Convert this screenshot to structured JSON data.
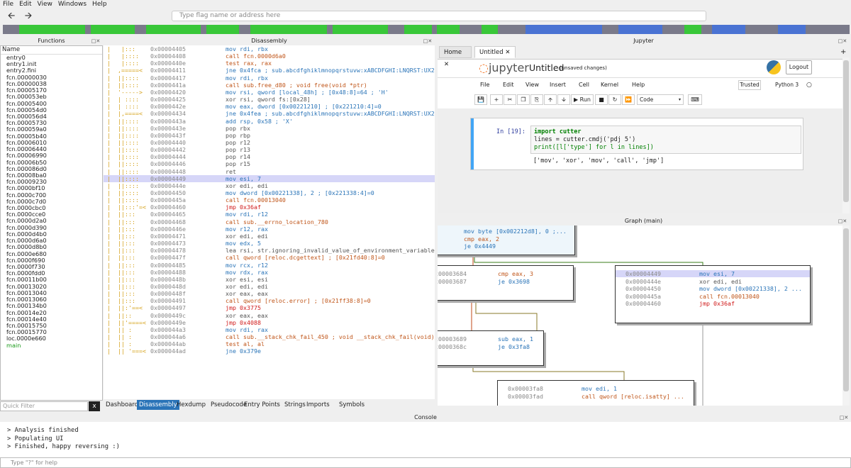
{
  "menu": [
    "File",
    "Edit",
    "View",
    "Windows",
    "Help"
  ],
  "flag_placeholder": "Type flag name or address here",
  "overview_colors": {
    "green": "#39c739",
    "grey": "#7a7a8a",
    "blue": "#4a73d3"
  },
  "functions": {
    "title": "Functions",
    "header": "Name",
    "items": [
      "entry0",
      "entry1.init",
      "entry2.fini",
      "fcn.00000030",
      "fcn.00000038",
      "fcn.00005170",
      "fcn.000053eb",
      "fcn.00005400",
      "fcn.000054d0",
      "fcn.000056d4",
      "fcn.00005730",
      "fcn.000059a0",
      "fcn.00005b40",
      "fcn.00006010",
      "fcn.00006440",
      "fcn.00006990",
      "fcn.00006b50",
      "fcn.000086d0",
      "fcn.00008ba0",
      "fcn.00009230",
      "fcn.0000bf10",
      "fcn.0000c700",
      "fcn.0000c7d0",
      "fcn.0000cbc0",
      "fcn.0000cce0",
      "fcn.0000d2a0",
      "fcn.0000d390",
      "fcn.0000d4b0",
      "fcn.0000d6a0",
      "fcn.0000d8b0",
      "fcn.0000e680",
      "fcn.0000f690",
      "fcn.0000f730",
      "fcn.0000fdd0",
      "fcn.00011b00",
      "fcn.00013020",
      "fcn.00013040",
      "fcn.00013060",
      "fcn.000134b0",
      "fcn.00014e20",
      "fcn.00014e40",
      "fcn.00015750",
      "fcn.00015770",
      "loc.0000e660",
      "main"
    ],
    "filter_placeholder": "Quick Filter",
    "filter_clear": "x"
  },
  "disassembly": {
    "title": "Disassembly",
    "lines": [
      {
        "g": "|   |:::    ",
        "a": "0x00004405",
        "i": "mov rdi, rbx",
        "c": "#2a74b8"
      },
      {
        "g": "|   |::::  ",
        "a": "0x00004408",
        "i": "call fcn.0000d6a0",
        "c": "#c0561a"
      },
      {
        "g": "|   |::::  ",
        "a": "0x0000440e",
        "i": "test rax, rax",
        "c": "#c0561a"
      },
      {
        "g": "|  ,=====< ",
        "a": "0x00004411",
        "i": "jne 0x4fca ; sub.abcdfghiklmnopqrstuvw:xABCDFGHI:LNQRST:UX2",
        "c": "#2a74b8"
      },
      {
        "g": "|  ||::::  ",
        "a": "0x00004417",
        "i": "mov rdi, rbx",
        "c": "#2a74b8"
      },
      {
        "g": "|  ||::::  ",
        "a": "0x0000441a",
        "i": "call sub.free_d80 ; void free(void *ptr)",
        "c": "#c0561a"
      },
      {
        "g": "|  '-----> ",
        "a": "0x00004420",
        "i": "mov rsi, qword [local_48h] ; [0x48:8]=64 ; 'H'",
        "c": "#2a74b8"
      },
      {
        "g": "|  | ::::  ",
        "a": "0x00004425",
        "i": "xor rsi, qword fs:[0x28]",
        "c": "#555"
      },
      {
        "g": "|  | ::::  ",
        "a": "0x0000442e",
        "i": "mov eax, dword [0x00221210] ; [0x221210:4]=0",
        "c": "#2a74b8"
      },
      {
        "g": "|  |,====< ",
        "a": "0x00004434",
        "i": "jne 0x4fea ; sub.abcdfghiklmnopqrstuvw:xABCDFGHI:LNQRST:UX2",
        "c": "#2a74b8"
      },
      {
        "g": "|  ||::::  ",
        "a": "0x0000443a",
        "i": "add rsp, 0x58 ; 'X'",
        "c": "#2a74b8"
      },
      {
        "g": "|  ||::::  ",
        "a": "0x0000443e",
        "i": "pop rbx",
        "c": "#555"
      },
      {
        "g": "|  ||::::  ",
        "a": "0x0000443f",
        "i": "pop rbp",
        "c": "#555"
      },
      {
        "g": "|  ||::::  ",
        "a": "0x00004440",
        "i": "pop r12",
        "c": "#555"
      },
      {
        "g": "|  ||::::  ",
        "a": "0x00004442",
        "i": "pop r13",
        "c": "#555"
      },
      {
        "g": "|  ||::::  ",
        "a": "0x00004444",
        "i": "pop r14",
        "c": "#555"
      },
      {
        "g": "|  ||::::  ",
        "a": "0x00004446",
        "i": "pop r15",
        "c": "#555"
      },
      {
        "g": "|  ||::::  ",
        "a": "0x00004448",
        "i": "ret",
        "c": "#555"
      },
      {
        "g": "|  ||::::  ",
        "a": "0x00004449",
        "i": "mov esi, 7",
        "c": "#2a74b8",
        "hl": true
      },
      {
        "g": "|  ||::::  ",
        "a": "0x0000444e",
        "i": "xor edi, edi",
        "c": "#555"
      },
      {
        "g": "|  ||::::  ",
        "a": "0x00004450",
        "i": "mov dword [0x00221338], 2 ; [0x221338:4]=0",
        "c": "#2a74b8"
      },
      {
        "g": "|  ||::::  ",
        "a": "0x0000445a",
        "i": "call fcn.00013040",
        "c": "#c0561a"
      },
      {
        "g": "|  ||:::'=< ",
        "a": "0x00004460",
        "i": "jmp 0x36af",
        "c": "#d01a1a"
      },
      {
        "g": "|  ||:::   ",
        "a": "0x00004465",
        "i": "mov rdi, r12",
        "c": "#2a74b8"
      },
      {
        "g": "|  ||:::   ",
        "a": "0x00004468",
        "i": "call sub.__errno_location_780",
        "c": "#c0561a"
      },
      {
        "g": "|  ||:::   ",
        "a": "0x0000446e",
        "i": "mov r12, rax",
        "c": "#2a74b8"
      },
      {
        "g": "|  ||:::   ",
        "a": "0x00004471",
        "i": "xor edi, edi",
        "c": "#555"
      },
      {
        "g": "|  ||:::   ",
        "a": "0x00004473",
        "i": "mov edx, 5",
        "c": "#2a74b8"
      },
      {
        "g": "|  ||:::   ",
        "a": "0x00004478",
        "i": "lea rsi, str.ignoring_invalid_value_of_environment_variable",
        "c": "#555"
      },
      {
        "g": "|  ||:::   ",
        "a": "0x0000447f",
        "i": "call qword [reloc.dcgettext] ; [0x21fd40:8]=0",
        "c": "#c0561a"
      },
      {
        "g": "|  ||:::   ",
        "a": "0x00004485",
        "i": "mov rcx, r12",
        "c": "#2a74b8"
      },
      {
        "g": "|  ||:::   ",
        "a": "0x00004488",
        "i": "mov rdx, rax",
        "c": "#2a74b8"
      },
      {
        "g": "|  ||:::   ",
        "a": "0x0000448b",
        "i": "xor esi, esi",
        "c": "#555"
      },
      {
        "g": "|  ||:::   ",
        "a": "0x0000448d",
        "i": "xor edi, edi",
        "c": "#555"
      },
      {
        "g": "|  ||:::   ",
        "a": "0x0000448f",
        "i": "xor eax, eax",
        "c": "#555"
      },
      {
        "g": "|  ||:::   ",
        "a": "0x00004491",
        "i": "call qword [reloc.error] ; [0x21ff38:8]=0",
        "c": "#c0561a"
      },
      {
        "g": "|  ||:'==< ",
        "a": "0x00004497",
        "i": "jmp 0x3775",
        "c": "#d01a1a"
      },
      {
        "g": "|  ||::    ",
        "a": "0x0000449c",
        "i": "xor eax, eax",
        "c": "#555"
      },
      {
        "g": "|  ||'====< ",
        "a": "0x0000449e",
        "i": "jmp 0x4088",
        "c": "#d01a1a"
      },
      {
        "g": "|  || :    ",
        "a": "0x000044a3",
        "i": "mov rdi, rax",
        "c": "#2a74b8"
      },
      {
        "g": "|  || :    ",
        "a": "0x000044a6",
        "i": "call sub.__stack_chk_fail_450 ; void __stack_chk_fail(void)",
        "c": "#c0561a"
      },
      {
        "g": "|  || :    ",
        "a": "0x000044ab",
        "i": "test al, al",
        "c": "#c0561a"
      },
      {
        "g": "|  || '===< ",
        "a": "0x000044ad",
        "i": "jne 0x379e",
        "c": "#2a74b8"
      }
    ]
  },
  "bottom_tabs": [
    "Dashboard",
    "Disassembly",
    "Hexdump",
    "Pseudocode",
    "Entry Points",
    "Strings",
    "Imports",
    "Symbols"
  ],
  "bottom_tab_active": "Disassembly",
  "jupyter": {
    "title": "Jupyter",
    "tabs": [
      "Home",
      "Untitled"
    ],
    "logo": "jupyter",
    "notebook_title": "Untitled",
    "unsaved": "(unsaved changes)",
    "logout": "Logout",
    "menu": [
      "File",
      "Edit",
      "View",
      "Insert",
      "Cell",
      "Kernel",
      "Help"
    ],
    "trusted": "Trusted",
    "kernel": "Python 3",
    "run": "Run",
    "cell_type": "Code",
    "prompt": "In [19]:",
    "code": [
      "import cutter",
      "lines = cutter.cmdj('pdj 5')",
      "print([l['type'] for l in lines])"
    ],
    "output": "['mov', 'xor', 'mov', 'call', 'jmp']"
  },
  "graph": {
    "title": "Graph (main)",
    "nodes": {
      "n1": [
        {
          "a": "",
          "i": "mov byte [0x002212d8], 0 ;...",
          "c": "#2a74b8"
        },
        {
          "a": "",
          "i": "cmp eax, 2",
          "c": "#c0561a"
        },
        {
          "a": "",
          "i": "je 0x4449",
          "c": "#2a74b8"
        }
      ],
      "n2": [
        {
          "a": "0x00003684",
          "i": "cmp eax, 3",
          "c": "#c0561a"
        },
        {
          "a": "0x00003687",
          "i": "je 0x3698",
          "c": "#2a74b8"
        }
      ],
      "n3": [
        {
          "a": "0x00004449",
          "i": "mov esi, 7",
          "c": "#2a74b8",
          "hl": true
        },
        {
          "a": "0x0000444e",
          "i": "xor edi, edi",
          "c": "#555"
        },
        {
          "a": "0x00004450",
          "i": "mov dword [0x00221338], 2 ...",
          "c": "#2a74b8"
        },
        {
          "a": "0x0000445a",
          "i": "call fcn.00013040",
          "c": "#c0561a"
        },
        {
          "a": "0x00004460",
          "i": "jmp 0x36af",
          "c": "#d01a1a"
        }
      ],
      "n4": [
        {
          "a": "0x00003689",
          "i": "sub eax, 1",
          "c": "#2a74b8"
        },
        {
          "a": "0x0000368c",
          "i": "je 0x3fa8",
          "c": "#2a74b8"
        }
      ],
      "n5": [
        {
          "a": "0x00003fa8",
          "i": "mov edi, 1",
          "c": "#2a74b8"
        },
        {
          "a": "0x00003fad",
          "i": "call qword [reloc.isatty] ...",
          "c": "#c0561a"
        }
      ]
    }
  },
  "console": {
    "title": "Console",
    "lines": [
      "> Analysis finished",
      "> Populating UI",
      "> Finished, happy reversing :)"
    ],
    "placeholder": "Type \"?\" for help"
  }
}
